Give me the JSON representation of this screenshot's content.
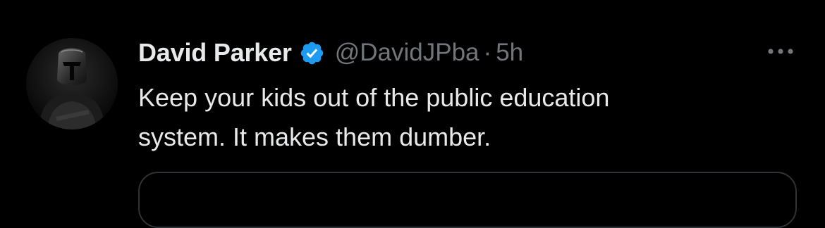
{
  "tweet": {
    "author": {
      "display_name": "David Parker",
      "handle": "@DavidJPba",
      "verified": true,
      "avatar_icon": "helmeted-figure-avatar"
    },
    "separator": "·",
    "time": "5h",
    "text_lines": [
      "Keep your kids out of the public education",
      "system. It makes them dumber."
    ],
    "more_icon": "more-horizontal-icon",
    "verified_icon": "verified-badge-icon"
  },
  "colors": {
    "background": "#000000",
    "primary_text": "#e7e9ea",
    "secondary_text": "#71767b",
    "verified_blue": "#1d9bf0",
    "border": "#2f3336"
  }
}
